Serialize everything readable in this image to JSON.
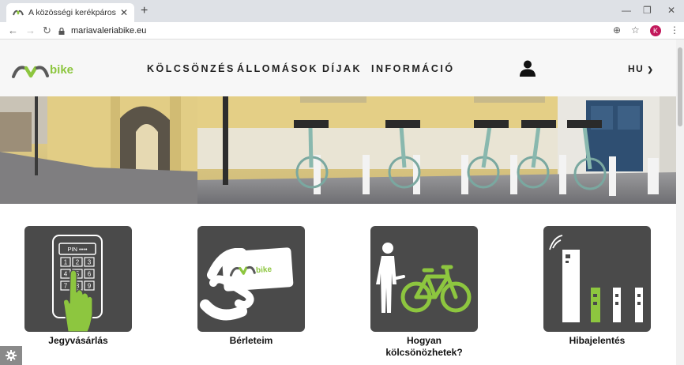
{
  "browser": {
    "tab_title": "A közösségi kerékpáros rendsze",
    "url": "mariavaleriabike.eu",
    "profile_initial": "K"
  },
  "site": {
    "logo_text": "bike",
    "nav": {
      "rent": "KÖLCSÖNZÉS",
      "stations": "ÁLLOMÁSOK",
      "fees": "DÍJAK",
      "info": "INFORMÁCIÓ"
    },
    "language": "HU"
  },
  "keypad": {
    "pin_label": "PIN ••••",
    "keys": [
      "1",
      "2",
      "3",
      "4",
      "5",
      "6",
      "7",
      "8",
      "9"
    ]
  },
  "tiles": {
    "ticket": "Jegyvásárlás",
    "passes": "Bérleteim",
    "how_to_line1": "Hogyan",
    "how_to_line2": "kölcsönözhetek?",
    "report": "Hibajelentés"
  },
  "colors": {
    "brand_green": "#8dc63f",
    "tile_gray": "#4a4a4a",
    "header_bg": "#f7f7f7"
  }
}
